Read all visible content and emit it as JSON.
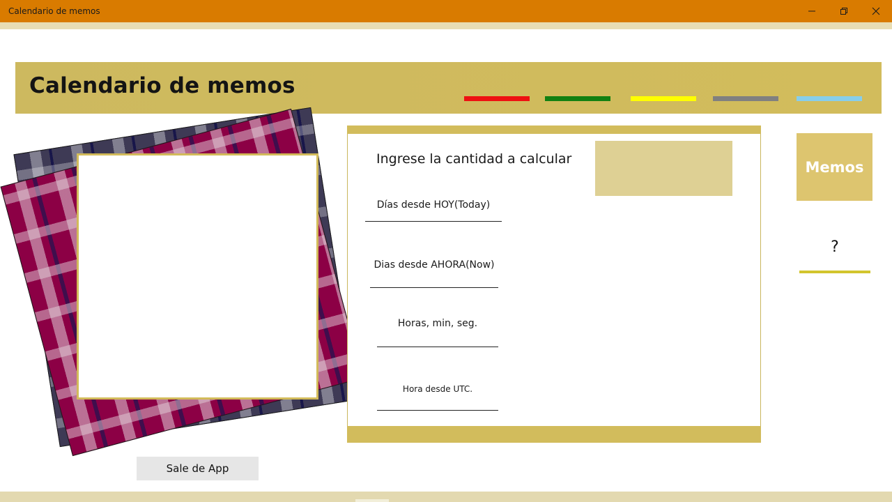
{
  "window": {
    "title": "Calendario de memos",
    "controls": [
      "minimize-icon",
      "restore-icon",
      "close-icon"
    ],
    "title_bar_color": "#d97b00"
  },
  "header": {
    "title": "Calendario de memos",
    "background_color": "#cdb95f",
    "color_tabs": [
      {
        "name": "red",
        "color": "#ee1111"
      },
      {
        "name": "green",
        "color": "#128012"
      },
      {
        "name": "yellow",
        "color": "#ffff00"
      },
      {
        "name": "gray",
        "color": "#808080"
      },
      {
        "name": "light-blue",
        "color": "#87ceeb"
      }
    ]
  },
  "calculator": {
    "prompt": "Ingrese la cantidad a calcular",
    "input_value": "",
    "fields": [
      {
        "label": "Días desde HOY(Today)"
      },
      {
        "label": "Dias desde AHORA(Now)"
      },
      {
        "label": "Horas, min, seg."
      },
      {
        "label": "Hora desde UTC."
      }
    ]
  },
  "sidebar": {
    "memos_label": "Memos",
    "help_label": "?"
  },
  "footer": {
    "exit_label": "Sale de App"
  },
  "colors": {
    "accent_gold": "#d2bc5c",
    "accent_light_gold": "#ddc56f",
    "input_fill": "#ded094",
    "help_underline": "#d2c52e"
  }
}
